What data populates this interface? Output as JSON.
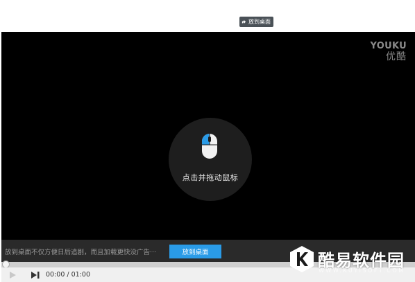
{
  "pin_button": {
    "label": "放到桌面",
    "icon": "pin-icon"
  },
  "logo": {
    "en": "YOUKU",
    "cn": "优酷"
  },
  "hint": {
    "text": "点击并拖动鼠标",
    "icon": "mouse-drag-icon"
  },
  "promo": {
    "text": "放到桌面不仅方便日后追剧，而且加载更快没广告···",
    "button_label": "放到桌面"
  },
  "progress": {
    "value_fraction": 0.0
  },
  "controls": {
    "time": "00:00 / 01:00",
    "play_icon": "play-icon",
    "next_icon": "next-icon"
  },
  "watermark": {
    "title": "酷易软件园",
    "url": "WWW.KUYISOFT.COM",
    "icon": "k-logo-icon"
  },
  "colors": {
    "accent": "#2a9be7",
    "player_bg": "#000000",
    "promo_bg": "#2a2a2a"
  }
}
